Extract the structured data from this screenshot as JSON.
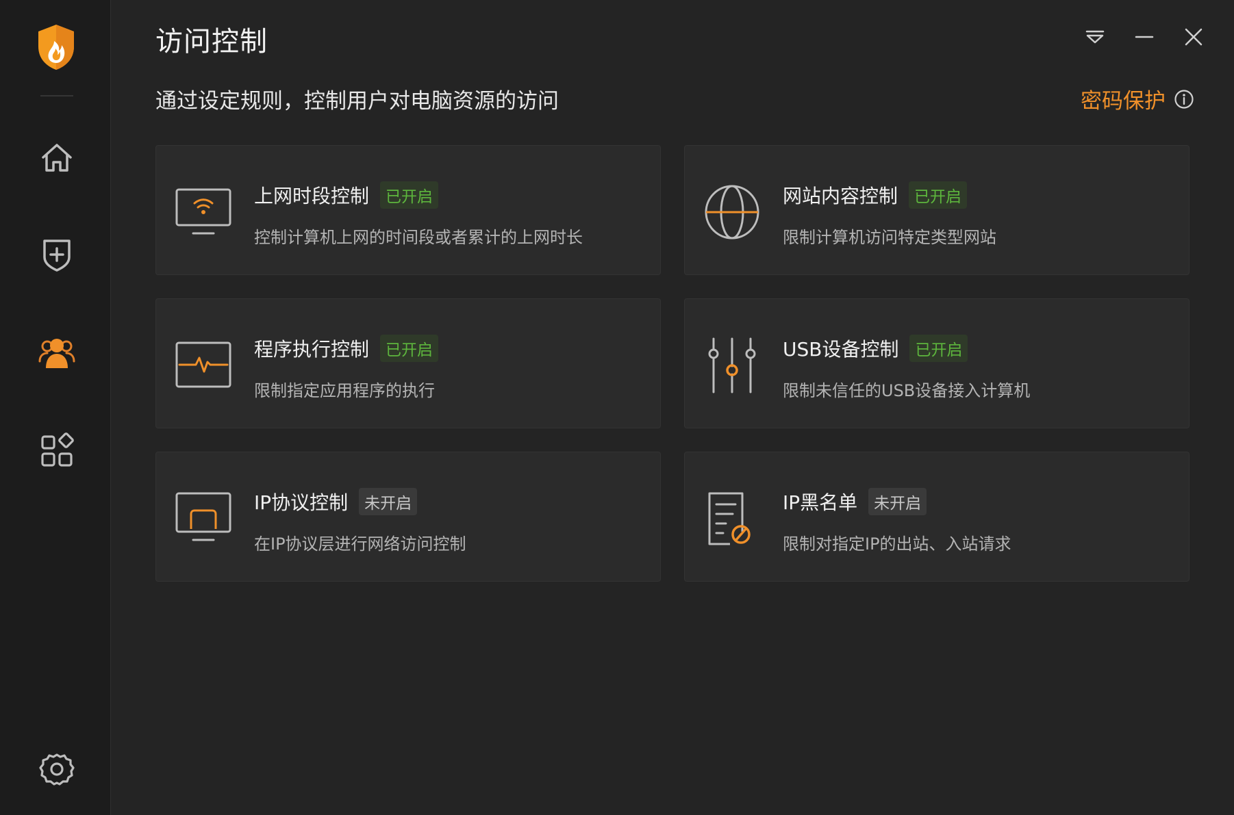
{
  "window": {
    "title": "访问控制",
    "controls": [
      "dropdown-icon",
      "minimize-icon",
      "close-icon"
    ]
  },
  "header": {
    "subtitle": "通过设定规则，控制用户对电脑资源的访问",
    "password_protect_label": "密码保护"
  },
  "sidebar": {
    "items": [
      {
        "name": "home-icon",
        "active": false
      },
      {
        "name": "shield-plus-icon",
        "active": false
      },
      {
        "name": "users-icon",
        "active": true
      },
      {
        "name": "apps-icon",
        "active": false
      }
    ],
    "settings_icon": "gear-icon"
  },
  "colors": {
    "accent": "#f0902a",
    "enabled": "#5db63d",
    "background": "#242424",
    "sidebar": "#1c1c1c",
    "card": "#2b2b2b"
  },
  "cards": [
    {
      "title": "上网时段控制",
      "status": "已开启",
      "desc": "控制计算机上网的时间段或者累计的上网时长",
      "icon": "monitor-wifi-icon"
    },
    {
      "title": "网站内容控制",
      "status": "已开启",
      "desc": "限制计算机访问特定类型网站",
      "icon": "globe-icon"
    },
    {
      "title": "程序执行控制",
      "status": "已开启",
      "desc": "限制指定应用程序的执行",
      "icon": "monitor-pulse-icon"
    },
    {
      "title": "USB设备控制",
      "status": "已开启",
      "desc": "限制未信任的USB设备接入计算机",
      "icon": "sliders-icon"
    },
    {
      "title": "IP协议控制",
      "status": "未开启",
      "desc": "在IP协议层进行网络访问控制",
      "icon": "monitor-window-icon"
    },
    {
      "title": "IP黑名单",
      "status": "未开启",
      "desc": "限制对指定IP的出站、入站请求",
      "icon": "document-blocked-icon"
    }
  ]
}
